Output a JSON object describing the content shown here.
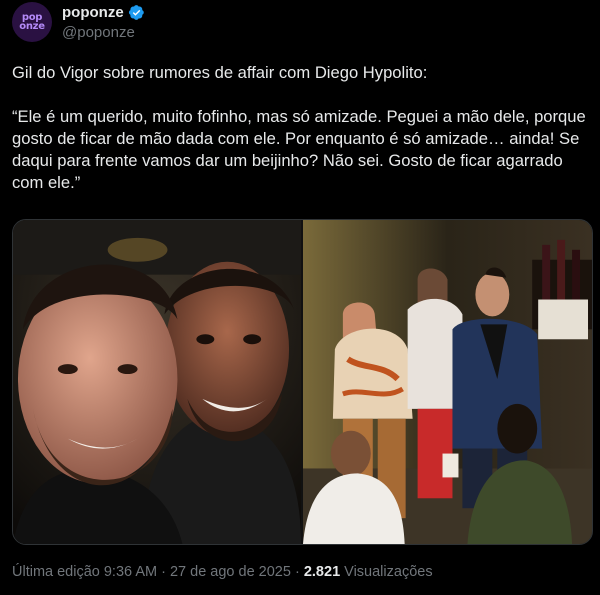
{
  "account": {
    "display_name": "poponze",
    "handle": "@poponze",
    "avatar_text_top": "pop",
    "avatar_text_bottom": "onze",
    "avatar_icon": "poponze-logo",
    "verified_icon": "verified-badge-icon",
    "verified_color": "#1d9bf0"
  },
  "post": {
    "intro": "Gil do Vigor sobre rumores de affair com Diego Hypolito:",
    "quote": "“Ele é um querido, muito fofinho, mas só amizade. Peguei a mão dele, porque gosto de ficar de mão dada com ele. Por enquanto é só amizade… ainda! Se daqui para frente vamos dar um beijinho? Não sei. Gosto de ficar agarrado com ele.”"
  },
  "media": {
    "left_photo": "selfie-photo",
    "right_photo": "event-photo"
  },
  "meta": {
    "edited": "Última edição 9:36 AM",
    "separator": "·",
    "date": "27 de ago de 2025",
    "views_count": "2.821",
    "views_label": "Visualizações"
  },
  "colors": {
    "background": "#000000",
    "text": "#e7e9ea",
    "secondary": "#71767b",
    "avatar_bg": "#2a1142",
    "avatar_fg": "#b48af7"
  }
}
